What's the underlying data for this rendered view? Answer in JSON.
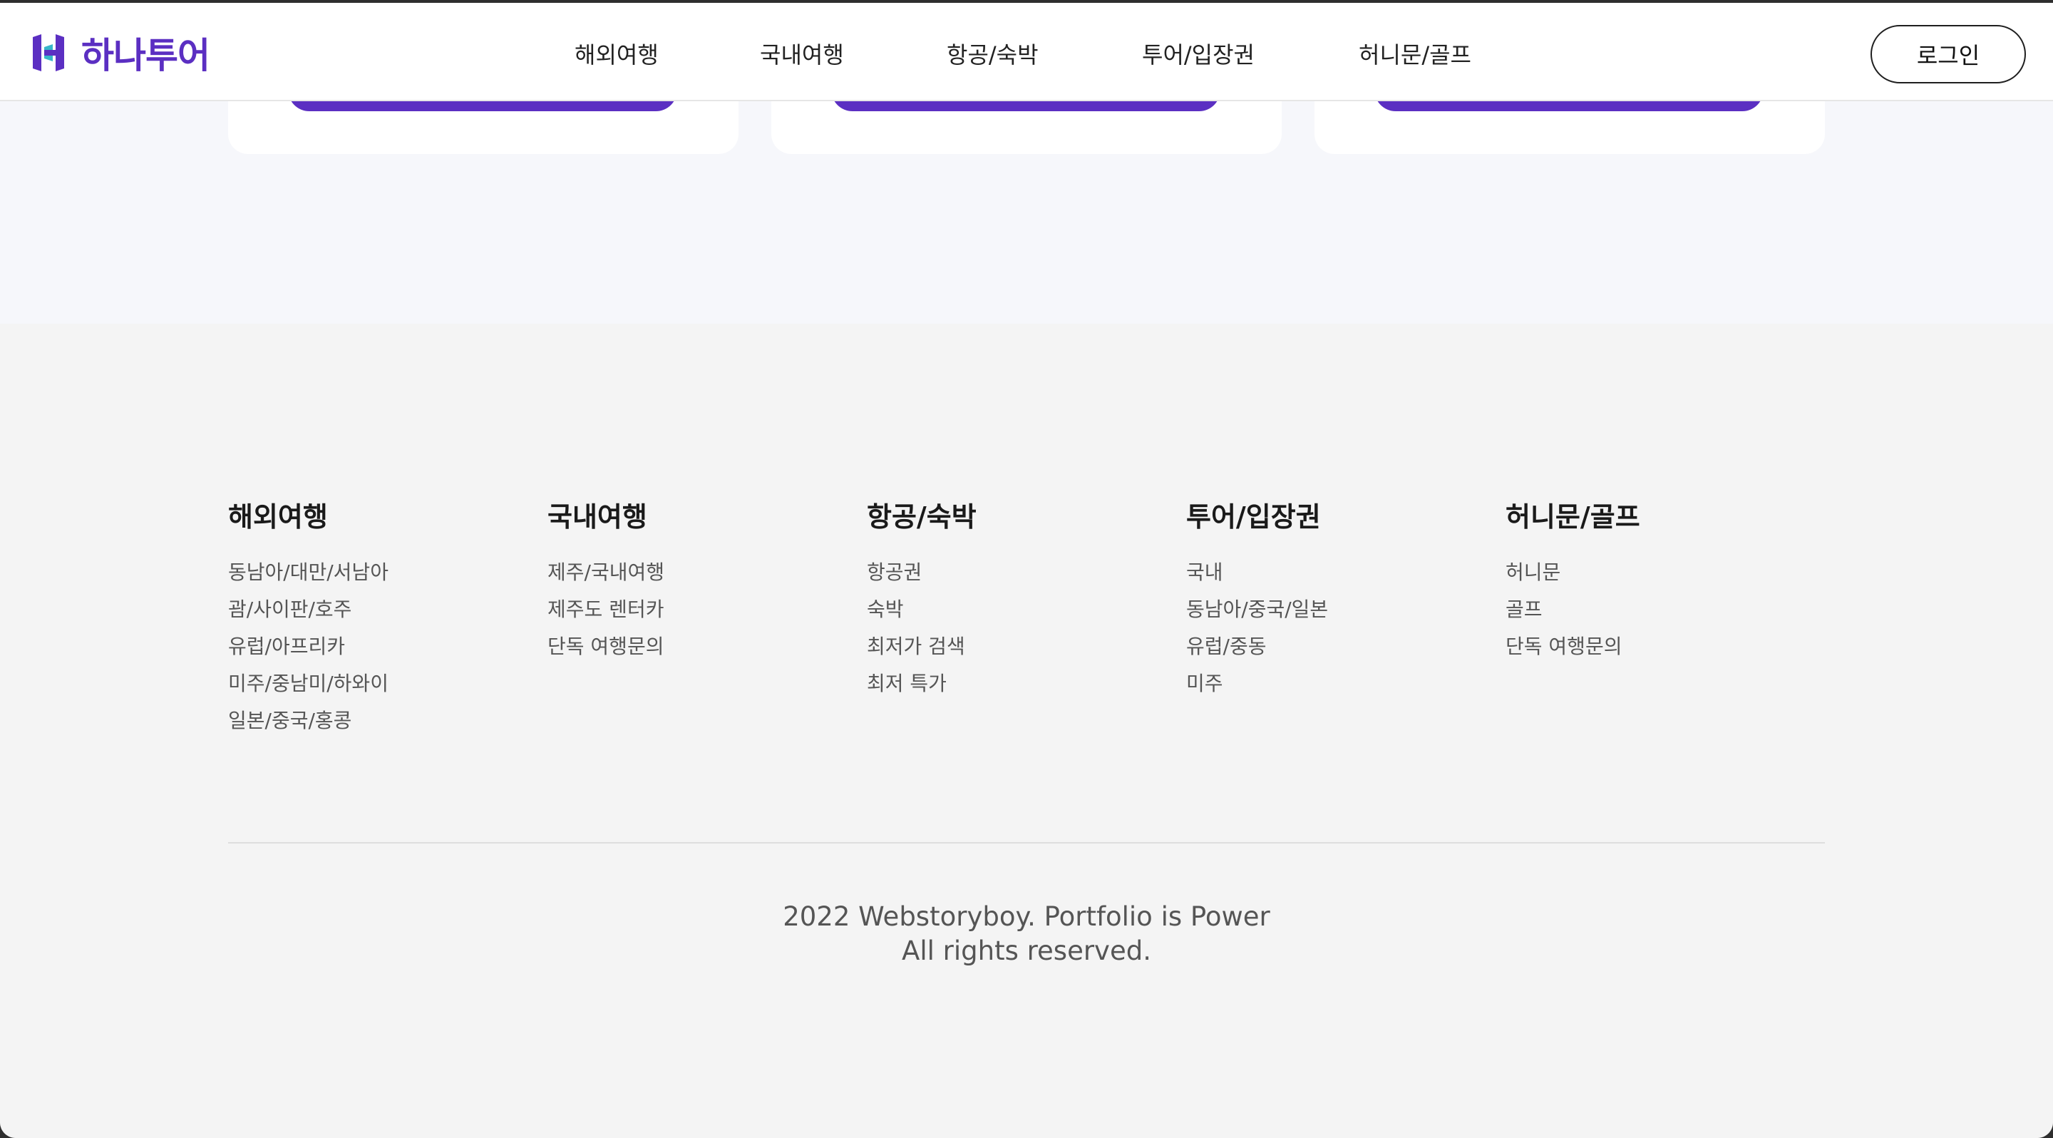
{
  "header": {
    "logo_text": "하나투어",
    "brand_color": "#5b2fc2",
    "nav": [
      {
        "label": "해외여행"
      },
      {
        "label": "국내여행"
      },
      {
        "label": "항공/숙박"
      },
      {
        "label": "투어/입장권"
      },
      {
        "label": "허니문/골프"
      }
    ],
    "login_label": "로그인"
  },
  "footer": {
    "columns": [
      {
        "title": "해외여행",
        "links": [
          "동남아/대만/서남아",
          "괌/사이판/호주",
          "유럽/아프리카",
          "미주/중남미/하와이",
          "일본/중국/홍콩"
        ]
      },
      {
        "title": "국내여행",
        "links": [
          "제주/국내여행",
          "제주도 렌터카",
          "단독 여행문의"
        ]
      },
      {
        "title": "항공/숙박",
        "links": [
          "항공권",
          "숙박",
          "최저가 검색",
          "최저 특가"
        ]
      },
      {
        "title": "투어/입장권",
        "links": [
          "국내",
          "동남아/중국/일본",
          "유럽/중동",
          "미주"
        ]
      },
      {
        "title": "허니문/골프",
        "links": [
          "허니문",
          "골프",
          "단독 여행문의"
        ]
      }
    ],
    "copyright_line1": "2022 Webstoryboy. Portfolio is Power",
    "copyright_line2": "All rights reserved."
  }
}
